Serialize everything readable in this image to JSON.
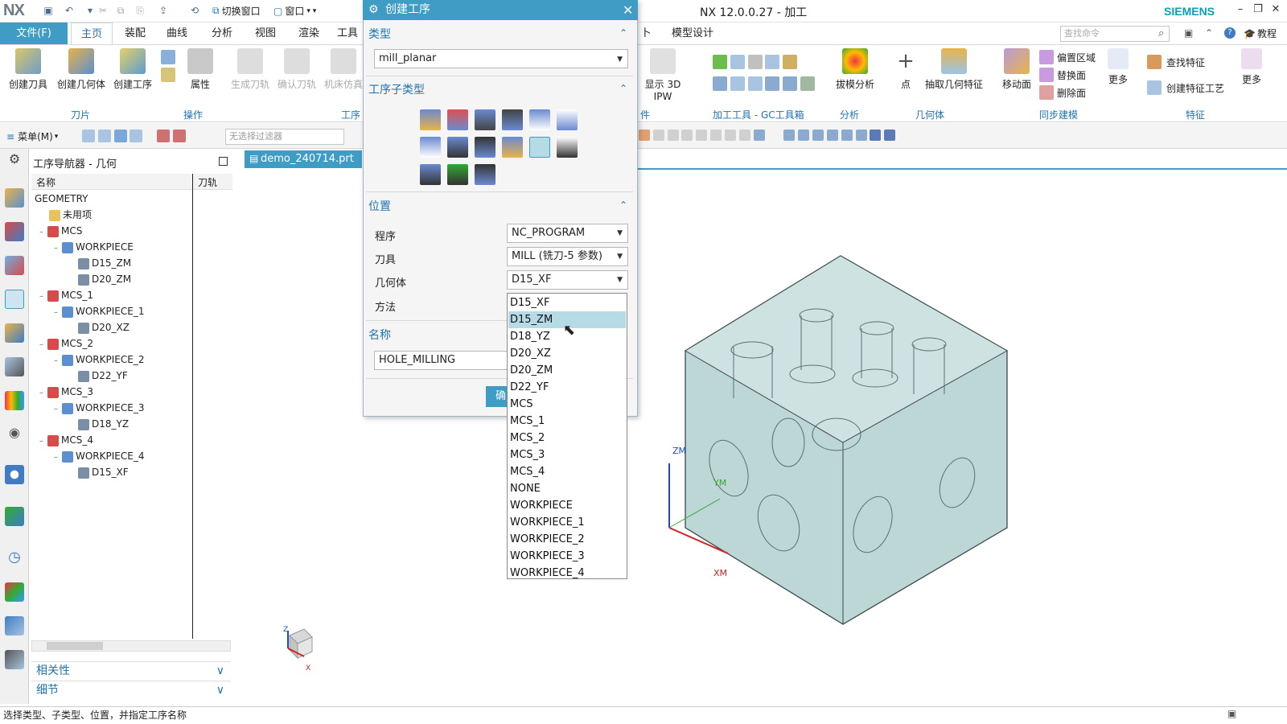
{
  "app": {
    "logo": "NX",
    "window_title": "NX 12.0.0.27 - 加工",
    "brand": "SIEMENS",
    "quick_access": {
      "switch_window": "切换窗口",
      "window": "窗口"
    }
  },
  "menu": {
    "file": "文件(F)",
    "tabs": [
      "主页",
      "装配",
      "曲线",
      "分析",
      "视图",
      "渲染",
      "工具"
    ],
    "tabs_right": [
      "模型设计"
    ],
    "search_placeholder": "查找命令",
    "tutorial": "教程"
  },
  "ribbon": {
    "left_buttons": [
      "创建刀具",
      "创建几何体",
      "创建工序"
    ],
    "property": "属性",
    "disabled_buttons": [
      "生成刀轨",
      "确认刀轨",
      "机床仿真"
    ],
    "display_ipw": "显示 3D IPW",
    "draft_analysis": "拔模分析",
    "point": "点",
    "extract_feature": "抽取几何特征",
    "move_face": "移动面",
    "sync_items": [
      "偏置区域",
      "替换面",
      "删除面"
    ],
    "more": "更多",
    "find_feature": "查找特征",
    "create_feature_process": "创建特征工艺",
    "more2": "更多",
    "groups": {
      "blade": "刀片",
      "operation": "操作",
      "process": "工序",
      "part": "件",
      "machining_tools": "加工工具 - GC工具箱",
      "analysis": "分析",
      "geometry": "几何体",
      "sync": "同步建模",
      "feature": "特征"
    }
  },
  "toolbar2": {
    "menu": "菜单(M)",
    "filter": "无选择过滤器"
  },
  "navigator": {
    "title": "工序导航器 - 几何",
    "col_name": "名称",
    "col_path": "刀轨",
    "tree": [
      {
        "label": "GEOMETRY",
        "level": 0,
        "icon": "none"
      },
      {
        "label": "未用项",
        "level": 1,
        "icon": "folder-icon"
      },
      {
        "label": "MCS",
        "level": 1,
        "icon": "mcs-icon"
      },
      {
        "label": "WORKPIECE",
        "level": 2,
        "icon": "workpiece-icon"
      },
      {
        "label": "D15_ZM",
        "level": 3,
        "icon": "geometry-icon"
      },
      {
        "label": "D20_ZM",
        "level": 3,
        "icon": "geometry-icon"
      },
      {
        "label": "MCS_1",
        "level": 1,
        "icon": "mcs-icon"
      },
      {
        "label": "WORKPIECE_1",
        "level": 2,
        "icon": "workpiece-icon"
      },
      {
        "label": "D20_XZ",
        "level": 3,
        "icon": "geometry-icon"
      },
      {
        "label": "MCS_2",
        "level": 1,
        "icon": "mcs-icon"
      },
      {
        "label": "WORKPIECE_2",
        "level": 2,
        "icon": "workpiece-icon"
      },
      {
        "label": "D22_YF",
        "level": 3,
        "icon": "geometry-icon"
      },
      {
        "label": "MCS_3",
        "level": 1,
        "icon": "mcs-icon"
      },
      {
        "label": "WORKPIECE_3",
        "level": 2,
        "icon": "workpiece-icon"
      },
      {
        "label": "D18_YZ",
        "level": 3,
        "icon": "geometry-icon"
      },
      {
        "label": "MCS_4",
        "level": 1,
        "icon": "mcs-icon"
      },
      {
        "label": "WORKPIECE_4",
        "level": 2,
        "icon": "workpiece-icon"
      },
      {
        "label": "D15_XF",
        "level": 3,
        "icon": "geometry-icon"
      }
    ],
    "dependency": "相关性",
    "details": "细节"
  },
  "graphics": {
    "tab": "demo_240714.prt",
    "axis_labels": {
      "zm": "ZM",
      "ym": "YM",
      "xm": "XM",
      "z": "Z",
      "x": "X"
    }
  },
  "dialog": {
    "title": "创建工序",
    "type_section": "类型",
    "type_value": "mill_planar",
    "subtype_section": "工序子类型",
    "location_section": "位置",
    "program_label": "程序",
    "program_value": "NC_PROGRAM",
    "tool_label": "刀具",
    "tool_value": "MILL (铣刀-5 参数)",
    "geometry_label": "几何体",
    "geometry_value": "D15_XF",
    "method_label": "方法",
    "name_section": "名称",
    "name_value": "HOLE_MILLING",
    "ok_button": "确"
  },
  "dropdown_options": [
    "D15_XF",
    "D15_ZM",
    "D18_YZ",
    "D20_XZ",
    "D20_ZM",
    "D22_YF",
    "MCS",
    "MCS_1",
    "MCS_2",
    "MCS_3",
    "MCS_4",
    "NONE",
    "WORKPIECE",
    "WORKPIECE_1",
    "WORKPIECE_2",
    "WORKPIECE_3",
    "WORKPIECE_4"
  ],
  "dropdown_selected": "D15_ZM",
  "status": "选择类型、子类型、位置，并指定工序名称",
  "colors": {
    "accent": "#3f9cc4",
    "link": "#1e73b4",
    "selection": "#b6dae6",
    "model": "#b8d3d3"
  }
}
